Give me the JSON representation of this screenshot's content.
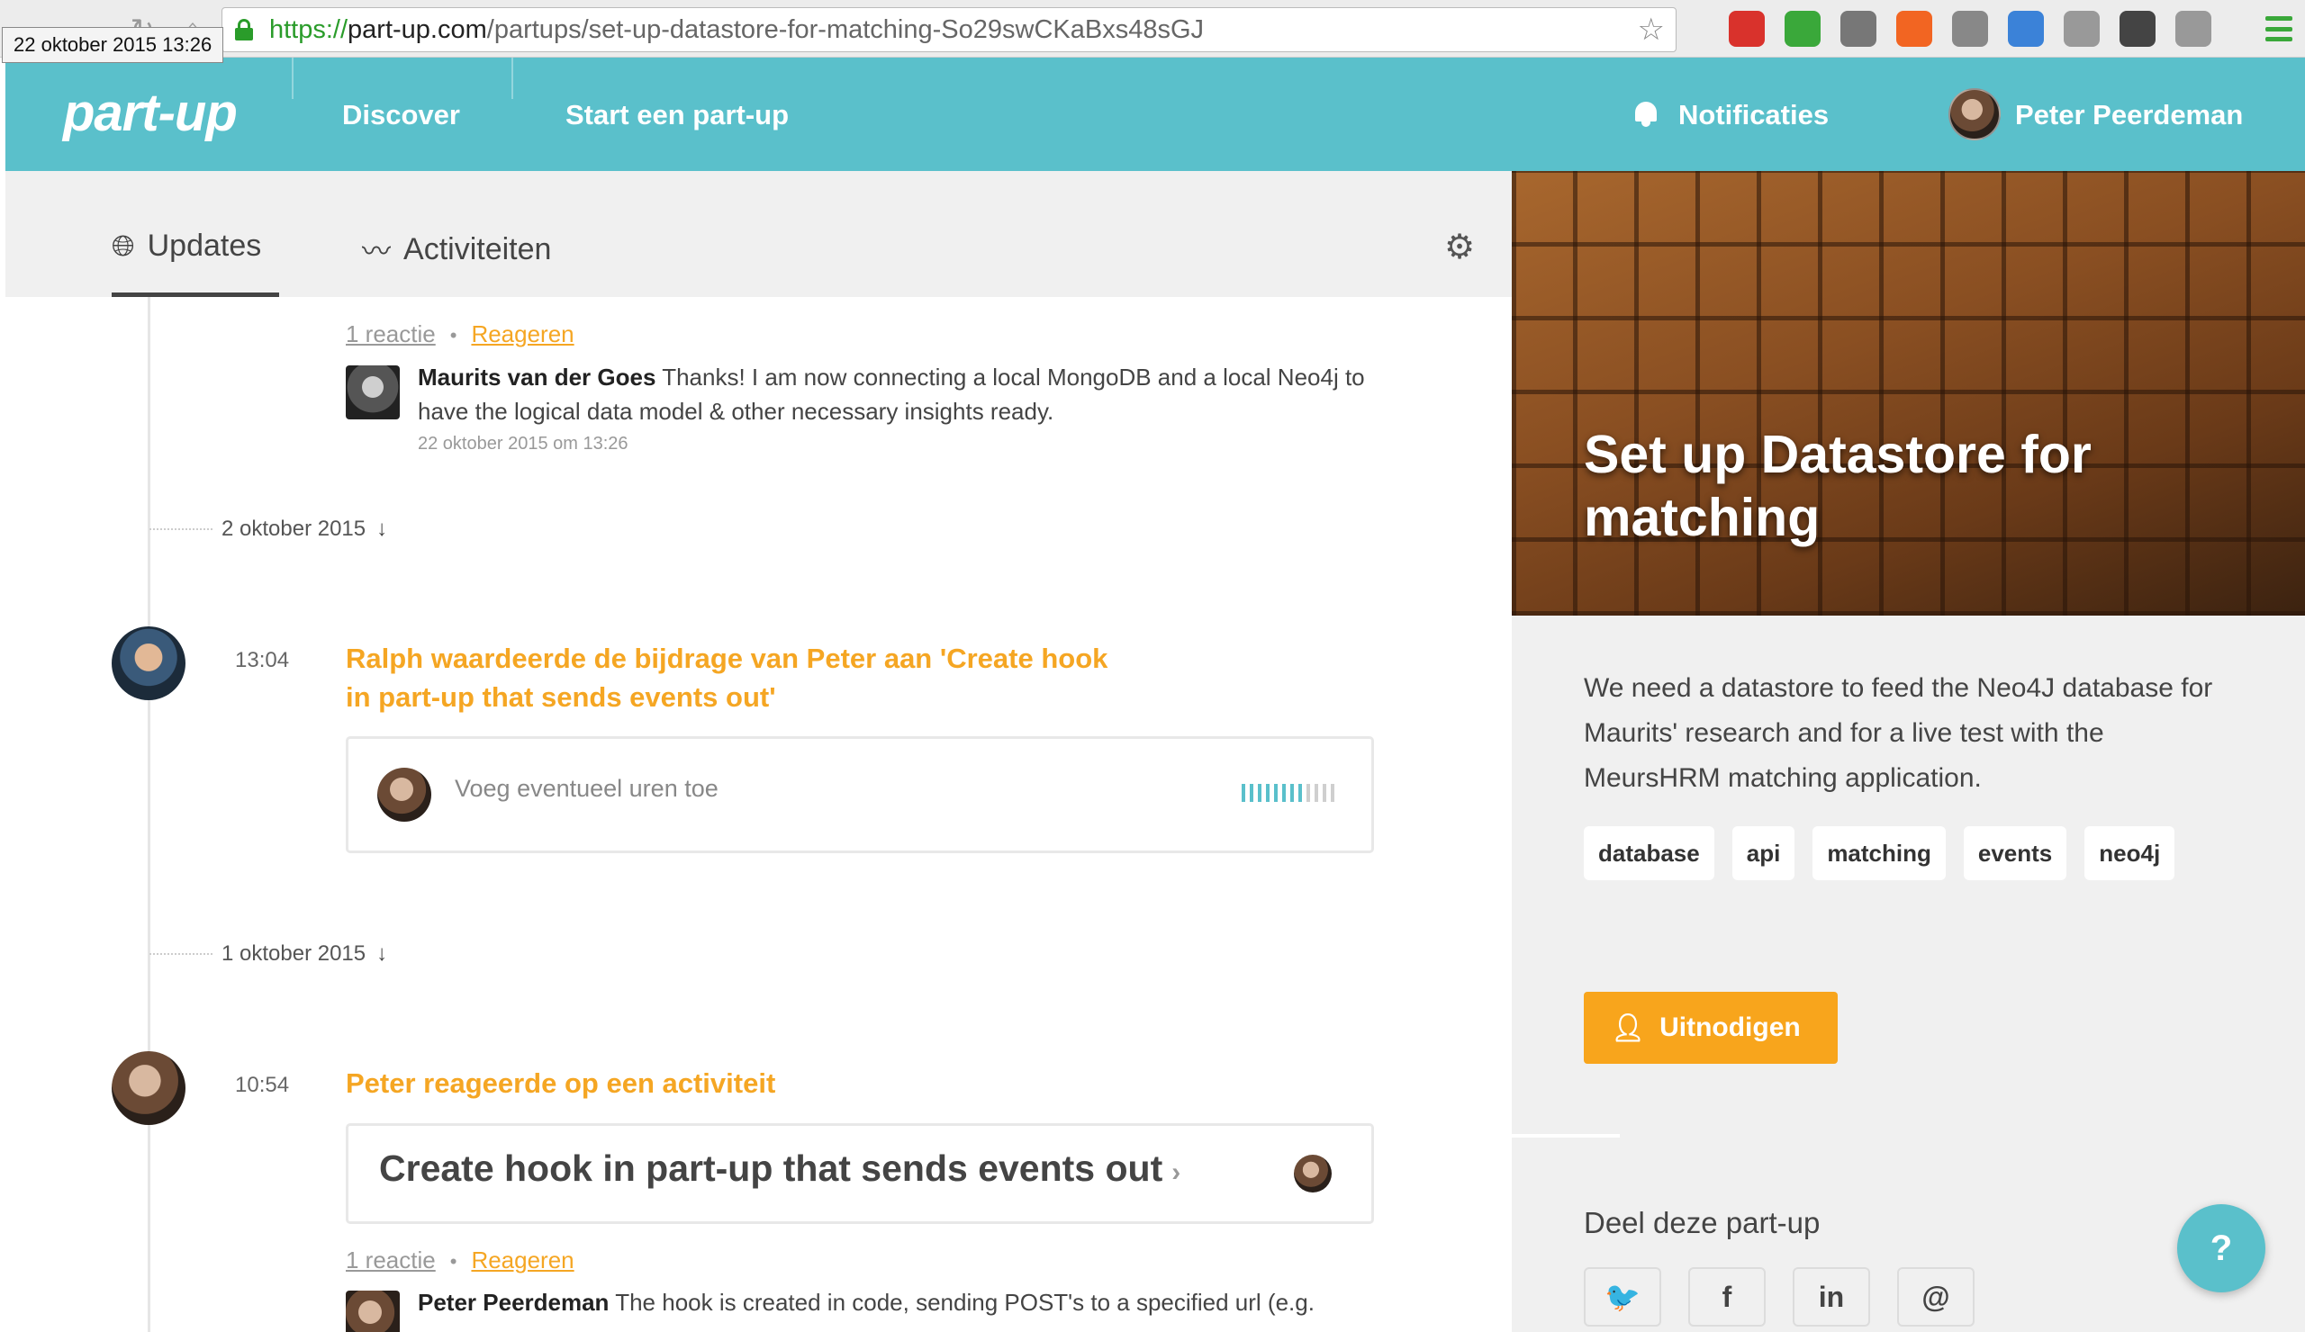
{
  "browser": {
    "tooltip": "22 oktober 2015 13:26",
    "url_proto": "https://",
    "url_host": "part-up.com",
    "url_path": "/partups/set-up-datastore-for-matching-So29swCKaBxs48sGJ",
    "extensions": [
      {
        "icon": "ublock-icon",
        "color": "#d9322c"
      },
      {
        "icon": "leaf-icon",
        "color": "#3aa83a"
      },
      {
        "icon": "plane-icon",
        "color": "#777777"
      },
      {
        "icon": "lifebuoy-icon",
        "color": "#f26522"
      },
      {
        "icon": "download-icon",
        "color": "#888888"
      },
      {
        "icon": "bracket-icon",
        "color": "#3b82d8"
      },
      {
        "icon": "react-icon",
        "color": "#999999"
      },
      {
        "icon": "pen-icon",
        "color": "#444444"
      },
      {
        "icon": "circle-icon",
        "color": "#999999"
      }
    ]
  },
  "nav": {
    "logo": "part-up",
    "discover": "Discover",
    "start": "Start een part-up",
    "notifications": "Notificaties",
    "user_name": "Peter Peerdeman"
  },
  "tabs": {
    "updates": "Updates",
    "activities": "Activiteiten"
  },
  "feed": {
    "top_reactions": "1 reactie",
    "top_reply": "Reageren",
    "comment1": {
      "author": "Maurits van der Goes",
      "text": "Thanks! I am now connecting a local MongoDB and a local Neo4j to have the logical data model & other necessary insights ready.",
      "date": "22 oktober 2015 om 13:26"
    },
    "date1": "2 oktober 2015",
    "activity1": {
      "time": "13:04",
      "title": "Ralph waardeerde de bijdrage van Peter aan 'Create hook in part-up that sends events out'",
      "hours_placeholder": "Voeg eventueel uren toe",
      "hours_ticks_on": 8,
      "hours_ticks_total": 12
    },
    "date2": "1 oktober 2015",
    "activity2": {
      "time": "10:54",
      "title": "Peter reageerde op een activiteit",
      "card_title": "Create hook in part-up that sends events out",
      "card_chevron": "›",
      "reactions": "1 reactie",
      "reply": "Reageren"
    },
    "comment2": {
      "author": "Peter Peerdeman",
      "text": "The hook is created in code, sending POST's to a specified url (e.g."
    }
  },
  "sidebar": {
    "title": "Set up Datastore for matching",
    "description": "We need a datastore to feed the Neo4J database for Maurits' research and for a live test with the MeursHRM matching application.",
    "tags": [
      "database",
      "api",
      "matching",
      "events",
      "neo4j"
    ],
    "invite": "Uitnodigen",
    "share_title": "Deel deze part-up",
    "share": [
      {
        "icon": "twitter-icon",
        "glyph": "🐦"
      },
      {
        "icon": "facebook-icon",
        "glyph": "f"
      },
      {
        "icon": "linkedin-icon",
        "glyph": "in"
      },
      {
        "icon": "email-icon",
        "glyph": "@"
      }
    ]
  },
  "help": {
    "glyph": "?"
  },
  "colors": {
    "brand": "#5ac0cb",
    "accent": "#f5a623",
    "invite": "#f8a51c"
  }
}
